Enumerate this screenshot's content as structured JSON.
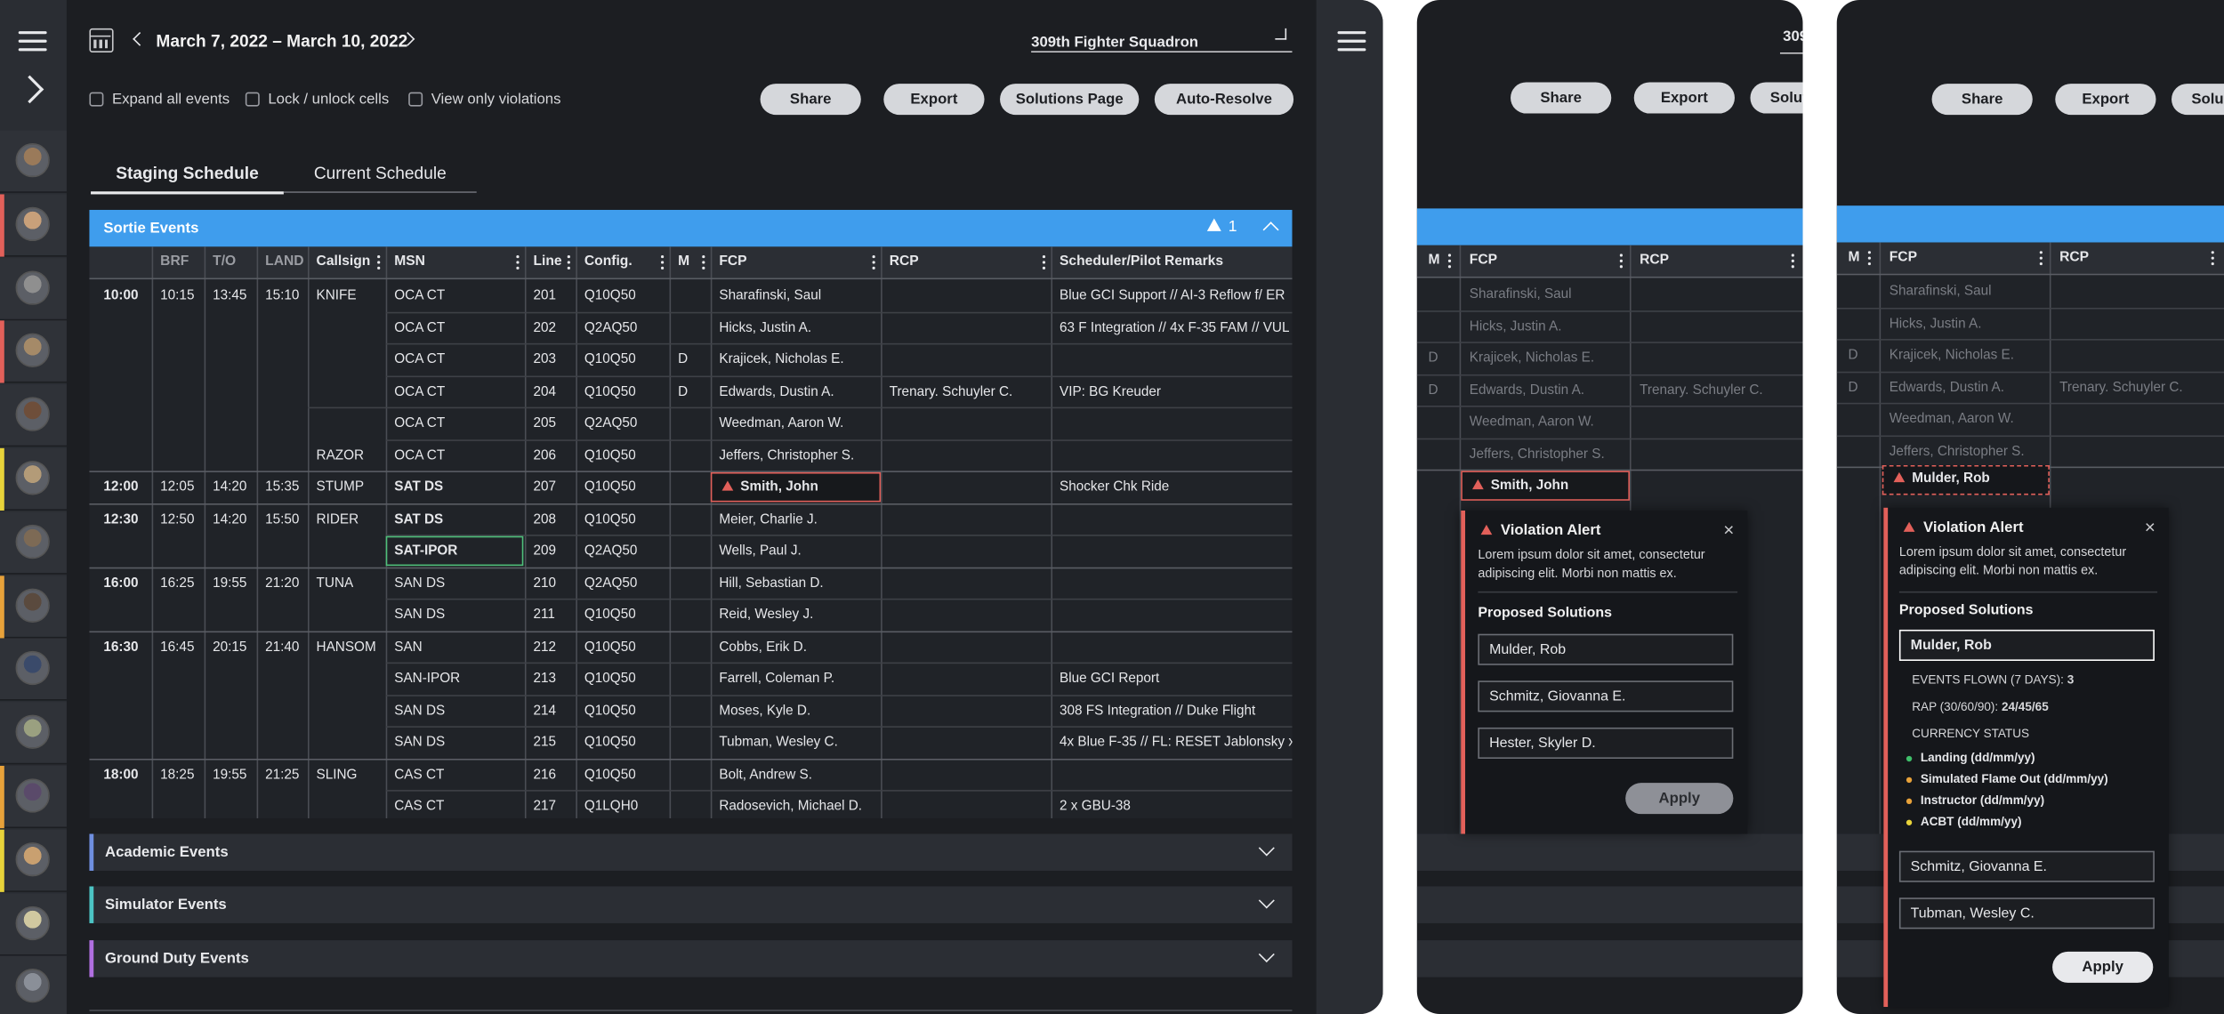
{
  "header": {
    "date_range": "March 7, 2022 – March 10, 2022",
    "squadron": "309th Fighter Squadron",
    "squadron_clip": "309"
  },
  "options": {
    "expand_all": "Expand all events",
    "lock_unlock": "Lock / unlock cells",
    "view_violations": "View only violations"
  },
  "actions": {
    "share": "Share",
    "export": "Export",
    "solutions": "Solutions Page",
    "auto_resolve": "Auto-Resolve",
    "solutions_clip": "Solut",
    "solutions_clip2": "Solu"
  },
  "tabs": {
    "staging": "Staging Schedule",
    "current": "Current Schedule"
  },
  "sortie": {
    "title": "Sortie Events",
    "violations": "1"
  },
  "columns": {
    "brf": "BRF",
    "to": "T/O",
    "land": "LAND",
    "callsign": "Callsign",
    "msn": "MSN",
    "line": "Line",
    "config": "Config.",
    "m": "M",
    "fcp": "FCP",
    "rcp": "RCP",
    "remarks": "Scheduler/Pilot Remarks"
  },
  "groups": [
    {
      "time": "10:00",
      "brf": "10:15",
      "to": "13:45",
      "land": "15:10"
    },
    {
      "time": "12:00",
      "brf": "12:05",
      "to": "14:20",
      "land": "15:35"
    },
    {
      "time": "12:30",
      "brf": "12:50",
      "to": "14:20",
      "land": "15:50"
    },
    {
      "time": "16:00",
      "brf": "16:25",
      "to": "19:55",
      "land": "21:20"
    },
    {
      "time": "16:30",
      "brf": "16:45",
      "to": "20:15",
      "land": "21:40"
    },
    {
      "time": "18:00",
      "brf": "18:25",
      "to": "19:55",
      "land": "21:25"
    }
  ],
  "callsigns": [
    "KNIFE",
    "RAZOR",
    "STUMP",
    "RIDER",
    "TUNA",
    "HANSOM",
    "SLING"
  ],
  "rows": [
    {
      "msn": "OCA CT",
      "line": "201",
      "config": "Q10Q50",
      "m": "",
      "fcp": "Sharafinski, Saul",
      "rcp": "",
      "remarks": "Blue GCI Support // AI-3 Reflow f/ ER"
    },
    {
      "msn": "OCA CT",
      "line": "202",
      "config": "Q2AQ50",
      "m": "",
      "fcp": "Hicks, Justin A.",
      "rcp": "",
      "remarks": "63 F Integration // 4x F-35 FAM // VUL"
    },
    {
      "msn": "OCA CT",
      "line": "203",
      "config": "Q10Q50",
      "m": "D",
      "fcp": "Krajicek, Nicholas E.",
      "rcp": "",
      "remarks": ""
    },
    {
      "msn": "OCA CT",
      "line": "204",
      "config": "Q10Q50",
      "m": "D",
      "fcp": "Edwards, Dustin A.",
      "rcp": "Trenary. Schuyler C.",
      "remarks": "VIP: BG Kreuder"
    },
    {
      "msn": "OCA CT",
      "line": "205",
      "config": "Q2AQ50",
      "m": "",
      "fcp": "Weedman, Aaron W.",
      "rcp": "",
      "remarks": ""
    },
    {
      "msn": "OCA CT",
      "line": "206",
      "config": "Q10Q50",
      "m": "",
      "fcp": "Jeffers, Christopher S.",
      "rcp": "",
      "remarks": ""
    },
    {
      "msn": "SAT DS",
      "line": "207",
      "config": "Q10Q50",
      "m": "",
      "fcp": "Smith, John",
      "rcp": "",
      "remarks": "Shocker Chk Ride"
    },
    {
      "msn": "SAT DS",
      "line": "208",
      "config": "Q10Q50",
      "m": "",
      "fcp": "Meier, Charlie J.",
      "rcp": "",
      "remarks": ""
    },
    {
      "msn": "SAT-IPOR",
      "line": "209",
      "config": "Q2AQ50",
      "m": "",
      "fcp": "Wells, Paul J.",
      "rcp": "",
      "remarks": ""
    },
    {
      "msn": "SAN DS",
      "line": "210",
      "config": "Q2AQ50",
      "m": "",
      "fcp": "Hill, Sebastian D.",
      "rcp": "",
      "remarks": ""
    },
    {
      "msn": "SAN DS",
      "line": "211",
      "config": "Q10Q50",
      "m": "",
      "fcp": "Reid, Wesley J.",
      "rcp": "",
      "remarks": ""
    },
    {
      "msn": "SAN",
      "line": "212",
      "config": "Q10Q50",
      "m": "",
      "fcp": "Cobbs, Erik D.",
      "rcp": "",
      "remarks": ""
    },
    {
      "msn": "SAN-IPOR",
      "line": "213",
      "config": "Q10Q50",
      "m": "",
      "fcp": "Farrell, Coleman P.",
      "rcp": "",
      "remarks": "Blue GCI Report"
    },
    {
      "msn": "SAN DS",
      "line": "214",
      "config": "Q10Q50",
      "m": "",
      "fcp": "Moses, Kyle D.",
      "rcp": "",
      "remarks": "308 FS Integration // Duke Flight"
    },
    {
      "msn": "SAN DS",
      "line": "215",
      "config": "Q10Q50",
      "m": "",
      "fcp": "Tubman, Wesley C.",
      "rcp": "",
      "remarks": "4x Blue F-35 // FL: RESET Jablonsky x"
    },
    {
      "msn": "CAS CT",
      "line": "216",
      "config": "Q10Q50",
      "m": "",
      "fcp": "Bolt, Andrew S.",
      "rcp": "",
      "remarks": ""
    },
    {
      "msn": "CAS CT",
      "line": "217",
      "config": "Q1LQH0",
      "m": "",
      "fcp": "Radosevich, Michael D.",
      "rcp": "",
      "remarks": "2 x GBU-38"
    }
  ],
  "sections": {
    "academic": "Academic Events",
    "simulator": "Simulator Events",
    "ground": "Ground Duty Events"
  },
  "alert": {
    "title": "Violation Alert",
    "body": "Lorem ipsum dolor sit amet, consectetur adipiscing elit. Morbi non mattis ex.",
    "proposed": "Proposed Solutions",
    "solutions": [
      "Mulder, Rob",
      "Schmitz, Giovanna E.",
      "Hester, Skyler D."
    ],
    "solutions_expanded": [
      "Schmitz, Giovanna E.",
      "Tubman, Wesley C."
    ],
    "apply": "Apply"
  },
  "detail": {
    "events_label": "EVENTS FLOWN (7 DAYS):",
    "events_value": "3",
    "rap_label": "RAP (30/60/90):",
    "rap_value": "24/45/65",
    "currency_title": "CURRENCY STATUS",
    "currency": [
      {
        "label": "Landing (dd/mm/yy)",
        "color": "#3fbf6a"
      },
      {
        "label": "Simulated Flame Out (dd/mm/yy)",
        "color": "#e8a23a"
      },
      {
        "label": "Instructor (dd/mm/yy)",
        "color": "#e8a23a"
      },
      {
        "label": "ACBT (dd/mm/yy)",
        "color": "#e8d33a"
      }
    ]
  },
  "colors": {
    "accent": "#3f9ded",
    "violation": "#e2605a",
    "selected": "#4fbf7a"
  }
}
